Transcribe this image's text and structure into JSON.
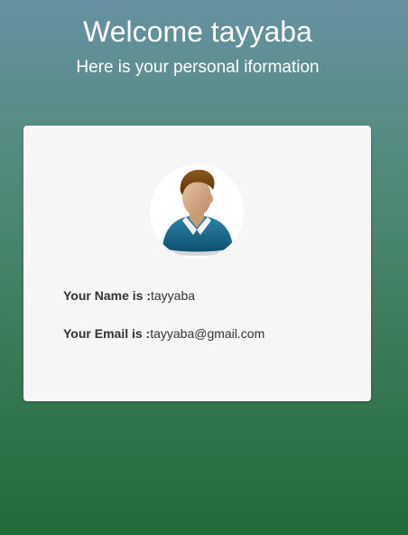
{
  "header": {
    "title": "Welcome tayyaba",
    "subtitle": "Here is your personal iformation"
  },
  "profile": {
    "avatar_icon": "user-avatar-icon",
    "name_label": "Your Name is :",
    "name_value": "tayyaba",
    "email_label": "Your Email is :",
    "email_value": "tayyaba@gmail.com"
  },
  "colors": {
    "background_top": "#6791a2",
    "background_bottom": "#216b3a",
    "card_background": "#f6f6f6",
    "text_dark": "#333333"
  }
}
